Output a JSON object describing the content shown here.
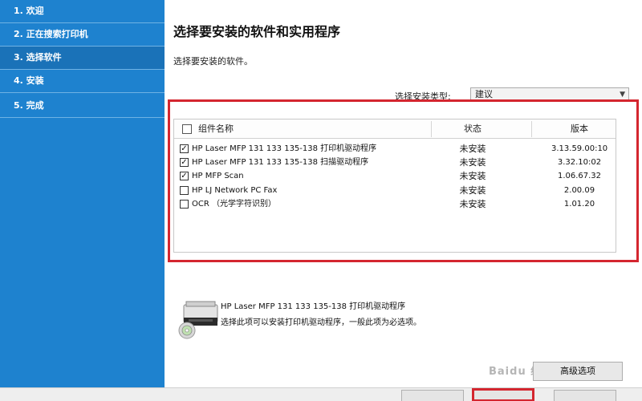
{
  "sidebar": {
    "steps": [
      {
        "label": "1. 欢迎"
      },
      {
        "label": "2. 正在搜索打印机"
      },
      {
        "label": "3. 选择软件"
      },
      {
        "label": "4. 安装"
      },
      {
        "label": "5. 完成"
      }
    ],
    "active_step": 3
  },
  "main": {
    "title": "选择要安装的软件和实用程序",
    "subtitle": "选择要安装的软件。",
    "install_type_label": "选择安装类型:",
    "install_type_value": "建议"
  },
  "table": {
    "headers": {
      "name": "组件名称",
      "status": "状态",
      "version": "版本"
    },
    "rows": [
      {
        "checked": true,
        "name": "HP Laser MFP 131 133 135-138 打印机驱动程序",
        "status": "未安装",
        "version": "3.13.59.00:10"
      },
      {
        "checked": true,
        "name": "HP Laser MFP 131 133 135-138 扫描驱动程序",
        "status": "未安装",
        "version": "3.32.10:02"
      },
      {
        "checked": true,
        "name": "HP MFP Scan",
        "status": "未安装",
        "version": "1.06.67.32"
      },
      {
        "checked": false,
        "name": "HP LJ Network PC Fax",
        "status": "未安装",
        "version": "2.00.09"
      },
      {
        "checked": false,
        "name": "OCR （光学字符识别）",
        "status": "未安装",
        "version": "1.01.20"
      }
    ]
  },
  "description": {
    "name": "HP Laser MFP 131 133 135-138 打印机驱动程序",
    "text": "选择此项可以安装打印机驱动程序，一般此项为必选项。"
  },
  "buttons": {
    "advanced": "高级选项"
  },
  "watermark": "Baidu 经验",
  "colors": {
    "sidebar": "#1e82cf",
    "highlight": "#d4262f"
  }
}
